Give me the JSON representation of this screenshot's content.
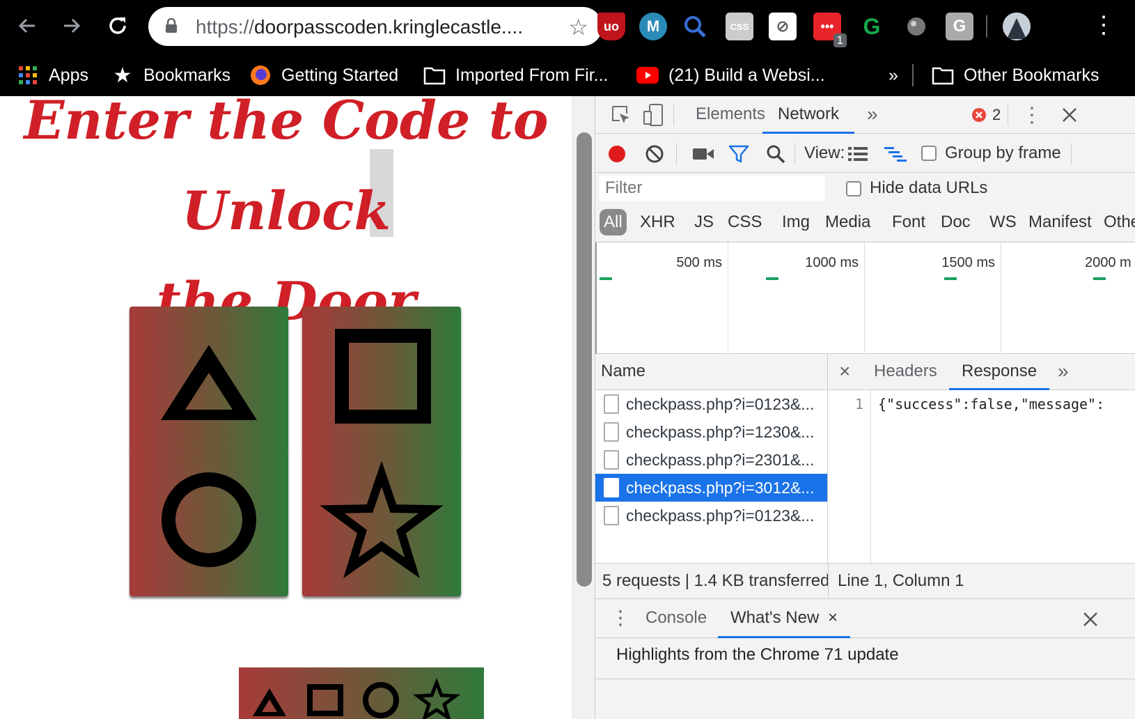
{
  "browser": {
    "url_scheme": "https://",
    "url_host": "doorpasscoden.kringlecastle....",
    "extension_badge": "1",
    "extensions": [
      "ublock-icon",
      "mailtrack-icon",
      "search-extension-icon",
      "css-viewer-icon",
      "eye-off-icon",
      "notification-extension-icon",
      "grammarly-icon",
      "globe-extension-icon",
      "g-extension-icon",
      "profile-avatar"
    ]
  },
  "bookmarks": {
    "apps": "Apps",
    "bookmarks": "Bookmarks",
    "getting_started": "Getting Started",
    "imported": "Imported From Fir...",
    "youtube": "(21) Build a Websi...",
    "overflow": "»",
    "other": "Other Bookmarks"
  },
  "page": {
    "title_line1": "Enter the Code to Unlock",
    "title_line2": "the Door",
    "keys": [
      "triangle",
      "square",
      "circle",
      "star"
    ],
    "colors": {
      "title": "#d01f26",
      "key_left": "#a83a3a",
      "key_right": "#2f7a3a"
    }
  },
  "devtools": {
    "tabs": {
      "elements": "Elements",
      "network": "Network",
      "more": "»"
    },
    "error_count": "2",
    "toolbar": {
      "view_label": "View:",
      "group_by_frame": "Group by frame"
    },
    "filter": {
      "placeholder": "Filter",
      "hide_data_urls": "Hide data URLs"
    },
    "types": [
      "All",
      "XHR",
      "JS",
      "CSS",
      "Img",
      "Media",
      "Font",
      "Doc",
      "WS",
      "Manifest",
      "Other"
    ],
    "overview_ticks": [
      "500 ms",
      "1000 ms",
      "1500 ms",
      "2000 m"
    ],
    "name_header": "Name",
    "requests": [
      "checkpass.php?i=0123&...",
      "checkpass.php?i=1230&...",
      "checkpass.php?i=2301&...",
      "checkpass.php?i=3012&...",
      "checkpass.php?i=0123&..."
    ],
    "selected_request": 3,
    "detail_tabs": {
      "close": "×",
      "headers": "Headers",
      "response": "Response",
      "more": "»"
    },
    "response": {
      "line_number": "1",
      "line": "{\"success\":false,\"message\":"
    },
    "status": {
      "summary": "5 requests | 1.4 KB transferred",
      "position": "Line 1, Column 1"
    },
    "drawer": {
      "console": "Console",
      "whats_new": "What's New",
      "close_tab": "×",
      "highlight": "Highlights from the Chrome 71 update"
    },
    "colors": {
      "accent": "#1a73e8",
      "record": "#e01b1b",
      "error": "#e8453c"
    }
  }
}
